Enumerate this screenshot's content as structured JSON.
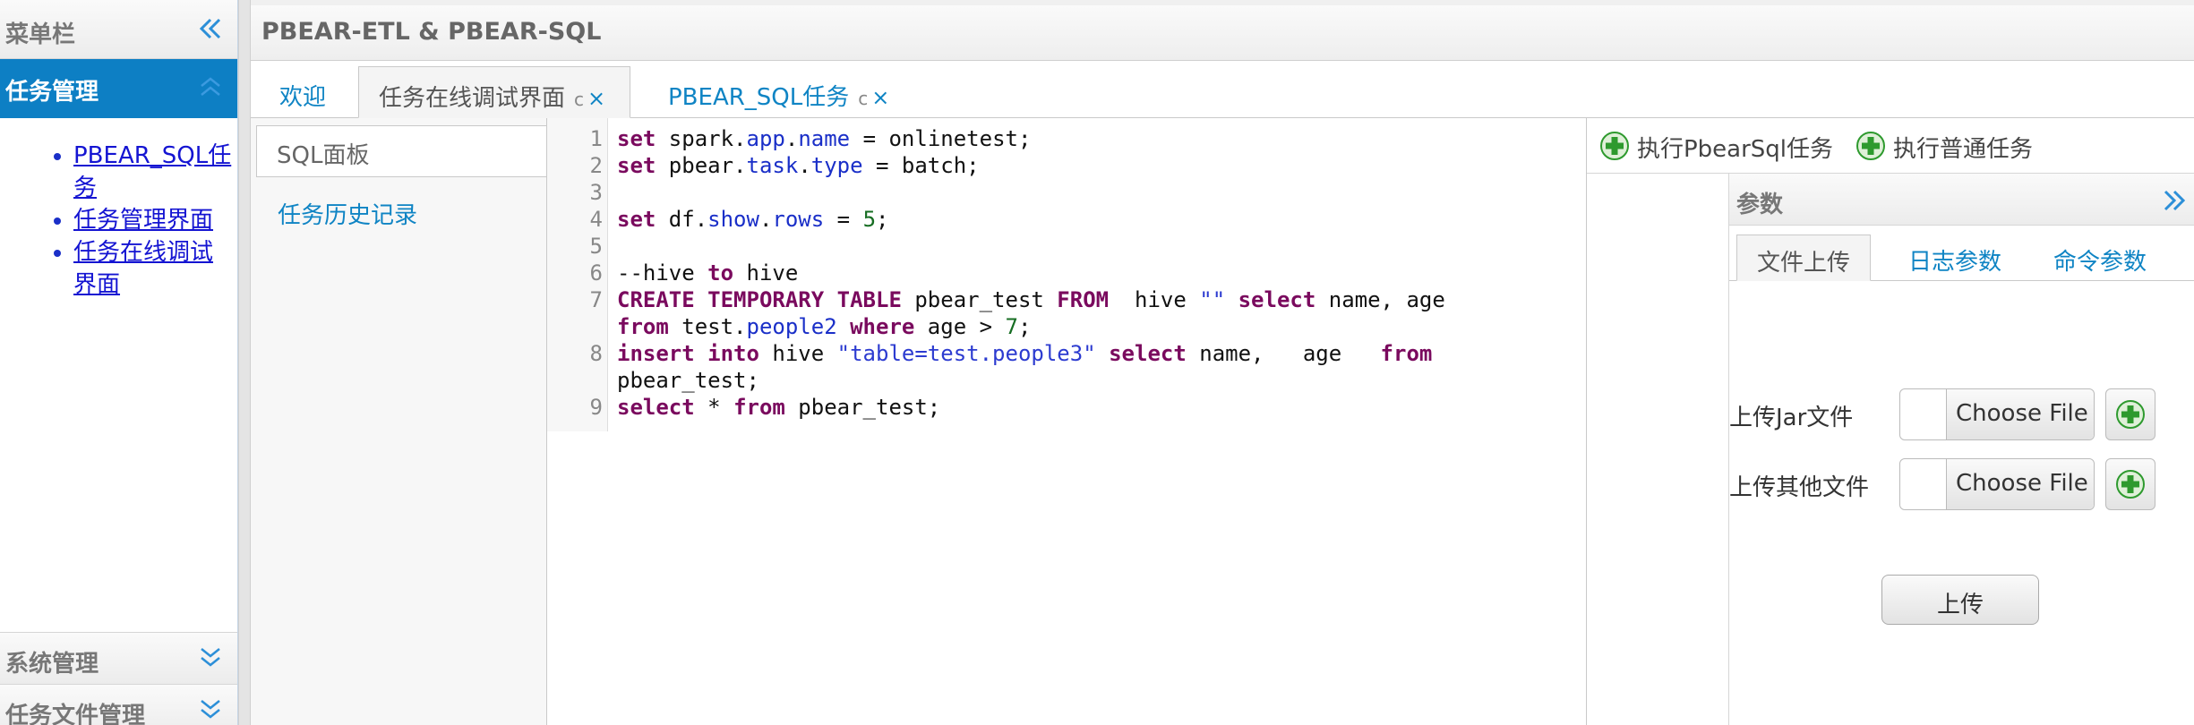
{
  "left_panel": {
    "title": "菜单栏",
    "active_section": "任务管理",
    "menu_items": [
      "PBEAR_SQL任务",
      "任务管理界面",
      "任务在线调试界面"
    ],
    "collapsed_sections": [
      "系统管理",
      "任务文件管理"
    ]
  },
  "main": {
    "title": "PBEAR-ETL & PBEAR-SQL",
    "tabs": [
      {
        "label": "欢迎"
      },
      {
        "label": "任务在线调试界面"
      },
      {
        "label": "PBEAR_SQL任务"
      }
    ],
    "tab_controls": {
      "refresh": "c",
      "close": "×"
    }
  },
  "sql_nav": {
    "panel_label": "SQL面板",
    "history_label": "任务历史记录"
  },
  "editor": {
    "line_numbers": [
      "1",
      "2",
      "3",
      "4",
      "5",
      "6",
      "7",
      "",
      "8",
      "",
      "9"
    ],
    "lines": [
      "set spark.app.name = onlinetest;",
      "set pbear.task.type = batch;",
      "",
      "set df.show.rows = 5;",
      "",
      "--hive to hive",
      "CREATE TEMPORARY TABLE pbear_test FROM  hive \"\" select name, age",
      "from test.people2 where age > 7;",
      "insert into hive \"table=test.people3\" select name,   age   from",
      "pbear_test;",
      "select * from pbear_test;"
    ]
  },
  "right_panel": {
    "toolbar": {
      "run_pbear_sql": "执行PbearSql任务",
      "run_normal": "执行普通任务"
    },
    "params_title": "参数",
    "param_tabs": [
      "文件上传",
      "日志参数",
      "命令参数"
    ],
    "upload_jar_label": "上传Jar文件",
    "upload_other_label": "上传其他文件",
    "choose_file": "Choose File",
    "upload_button": "上传"
  },
  "colors": {
    "accent": "#0d7fc4",
    "link": "#0f84c4",
    "keyword": "#7a0a5e",
    "plus_green": "#2e9a2e"
  }
}
